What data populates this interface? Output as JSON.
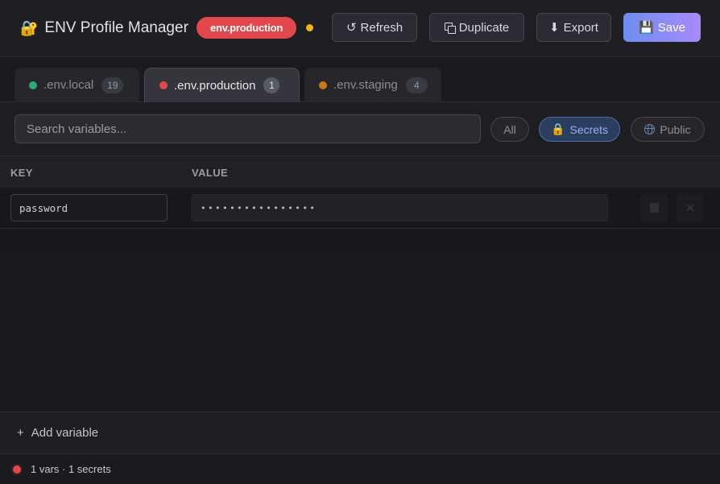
{
  "header": {
    "app_title": "ENV Profile Manager",
    "active_env_badge": "env.production",
    "buttons": {
      "refresh": "Refresh",
      "duplicate": "Duplicate",
      "export": "Export",
      "save": "Save"
    },
    "status_color": "#f2b21c"
  },
  "tabs": [
    {
      "label": ".env.local",
      "count": "19",
      "dot_color": "#2aa876",
      "active": false
    },
    {
      "label": ".env.production",
      "count": "1",
      "dot_color": "#e0484d",
      "active": true
    },
    {
      "label": ".env.staging",
      "count": "4",
      "dot_color": "#c9781e",
      "active": false
    }
  ],
  "filter": {
    "search_placeholder": "Search variables...",
    "pills": {
      "all": "All",
      "secrets": "Secrets",
      "public": "Public"
    },
    "selected": "Secrets"
  },
  "table": {
    "columns": {
      "key": "KEY",
      "value": "VALUE"
    },
    "rows": [
      {
        "key": "password",
        "value": "••••••••••••••••",
        "is_secret": true
      }
    ]
  },
  "add_variable_label": "Add variable",
  "status_bar": {
    "summary": "1 vars · 1 secrets",
    "indicator_color": "#e0484d"
  },
  "colors": {
    "accent": "#8a8cf5",
    "danger": "#e0484d",
    "warning": "#f2b21c"
  }
}
